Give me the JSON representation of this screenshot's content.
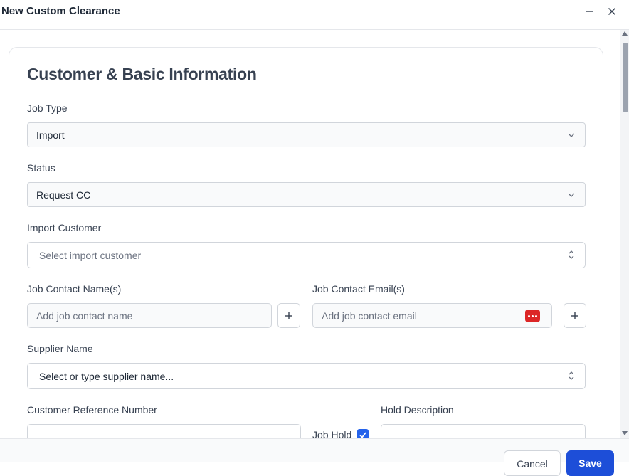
{
  "window": {
    "title": "New Custom Clearance",
    "minimize_icon": "minimize-icon",
    "close_icon": "close-icon"
  },
  "section": {
    "title": "Customer & Basic Information"
  },
  "job_type": {
    "label": "Job Type",
    "value": "Import"
  },
  "status": {
    "label": "Status",
    "value": "Request CC"
  },
  "import_customer": {
    "label": "Import Customer",
    "placeholder": "Select import customer"
  },
  "job_contact_name": {
    "label": "Job Contact Name(s)",
    "placeholder": "Add job contact name"
  },
  "job_contact_email": {
    "label": "Job Contact Email(s)",
    "placeholder": "Add job contact email"
  },
  "supplier": {
    "label": "Supplier Name",
    "value": "Select or type supplier name..."
  },
  "customer_reference": {
    "label": "Customer Reference Number",
    "value": ""
  },
  "job_hold": {
    "label": "Job Hold",
    "checked": true
  },
  "hold_description": {
    "label": "Hold Description",
    "value": ""
  },
  "footer": {
    "cancel_label": "Cancel",
    "save_label": "Save"
  },
  "colors": {
    "accent": "#1d4ed8",
    "checkbox": "#2563eb",
    "password_manager_icon": "#dc2626"
  }
}
